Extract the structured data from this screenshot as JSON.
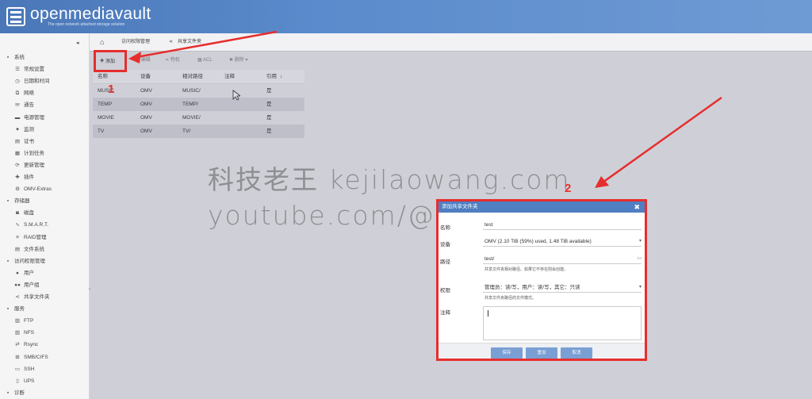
{
  "app": {
    "name": "openmediavault",
    "tagline": "The open network attached storage solution"
  },
  "sidebar": {
    "collapse_icon": "chevron-left-icon",
    "rows": [
      {
        "kind": "section",
        "label": "系统",
        "icon": "square-minus-icon",
        "glyph": "▪"
      },
      {
        "kind": "item",
        "label": "常规设置",
        "icon": "sliders-icon",
        "glyph": "☰"
      },
      {
        "kind": "item",
        "label": "日期和时间",
        "icon": "clock-icon",
        "glyph": "◷"
      },
      {
        "kind": "item",
        "label": "网络",
        "icon": "network-icon",
        "glyph": "⧉"
      },
      {
        "kind": "item",
        "label": "通告",
        "icon": "envelope-icon",
        "glyph": "✉"
      },
      {
        "kind": "item",
        "label": "电源管理",
        "icon": "power-icon",
        "glyph": "▬"
      },
      {
        "kind": "item",
        "label": "监测",
        "icon": "heartbeat-icon",
        "glyph": "♥"
      },
      {
        "kind": "item",
        "label": "证书",
        "icon": "certificate-icon",
        "glyph": "▤"
      },
      {
        "kind": "item",
        "label": "计划任务",
        "icon": "calendar-icon",
        "glyph": "▦"
      },
      {
        "kind": "item",
        "label": "更新管理",
        "icon": "download-icon",
        "glyph": "⟳"
      },
      {
        "kind": "item",
        "label": "插件",
        "icon": "puzzle-icon",
        "glyph": "✚"
      },
      {
        "kind": "item",
        "label": "OMV-Extras",
        "icon": "gear-icon",
        "glyph": "⚙"
      },
      {
        "kind": "section",
        "label": "存储器",
        "icon": "square-minus-icon",
        "glyph": "▪"
      },
      {
        "kind": "item",
        "label": "磁盘",
        "icon": "disk-icon",
        "glyph": "◙"
      },
      {
        "kind": "item",
        "label": "S.M.A.R.T.",
        "icon": "pulse-icon",
        "glyph": "∿"
      },
      {
        "kind": "item",
        "label": "RAID管理",
        "icon": "raid-icon",
        "glyph": "≡"
      },
      {
        "kind": "item",
        "label": "文件系统",
        "icon": "folder-tree-icon",
        "glyph": "▤"
      },
      {
        "kind": "section",
        "label": "访问权限管理",
        "icon": "square-minus-icon",
        "glyph": "▪"
      },
      {
        "kind": "item",
        "label": "用户",
        "icon": "user-icon",
        "glyph": "●"
      },
      {
        "kind": "item",
        "label": "用户组",
        "icon": "users-icon",
        "glyph": "●●"
      },
      {
        "kind": "item",
        "label": "共享文件夹",
        "icon": "share-icon",
        "glyph": "⋖"
      },
      {
        "kind": "section",
        "label": "服务",
        "icon": "square-minus-icon",
        "glyph": "▪"
      },
      {
        "kind": "item",
        "label": "FTP",
        "icon": "server-icon",
        "glyph": "▥"
      },
      {
        "kind": "item",
        "label": "NFS",
        "icon": "server-icon",
        "glyph": "▥"
      },
      {
        "kind": "item",
        "label": "Rsync",
        "icon": "sync-icon",
        "glyph": "⇄"
      },
      {
        "kind": "item",
        "label": "SMB/CIFS",
        "icon": "windows-icon",
        "glyph": "⊞"
      },
      {
        "kind": "item",
        "label": "SSH",
        "icon": "terminal-icon",
        "glyph": "▭"
      },
      {
        "kind": "item",
        "label": "UPS",
        "icon": "battery-icon",
        "glyph": "▯"
      },
      {
        "kind": "section",
        "label": "诊断",
        "icon": "square-minus-icon",
        "glyph": "▪"
      }
    ]
  },
  "breadcrumb": {
    "home_icon": "home-icon",
    "items": [
      "访问权限管理",
      "共享文件夹"
    ]
  },
  "toolbar": {
    "add": "添加",
    "edit": "编辑",
    "privileges": "特权",
    "acl": "ACL",
    "delete": "删除"
  },
  "grid": {
    "columns": [
      "名称",
      "设备",
      "相对路径",
      "注释",
      "引用"
    ],
    "rows": [
      [
        "MUSIC",
        "OMV",
        "MUSIC/",
        "",
        "是"
      ],
      [
        "TEMP",
        "OMV",
        "TEMP/",
        "",
        "是"
      ],
      [
        "MOVIE",
        "OMV",
        "MOVIE/",
        "",
        "是"
      ],
      [
        "TV",
        "OMV",
        "TV/",
        "",
        "是"
      ]
    ]
  },
  "watermark": {
    "line1": "科技老王 kejilaowang.com",
    "line2": "youtube.com/@科技老王"
  },
  "dialog": {
    "title": "添加共享文件夹",
    "name_label": "名称",
    "name_value": "test",
    "device_label": "设备",
    "device_value": "OMV (2.10 TiB (59%) used, 1.48 TiB available)",
    "path_label": "路径",
    "path_value": "test/",
    "path_hint": "共享文件夹相对路径。如果它不存在则会创建。",
    "perm_label": "权限",
    "perm_value": "管理员：读/写，用户：读/写，其它：只读",
    "perm_hint": "共享文件夹路径的文件模式。",
    "comment_label": "注释",
    "save": "保存",
    "reset": "重设",
    "cancel": "取消"
  },
  "annotations": {
    "n1": "1",
    "n2": "2",
    "color": "#e62e2e"
  }
}
